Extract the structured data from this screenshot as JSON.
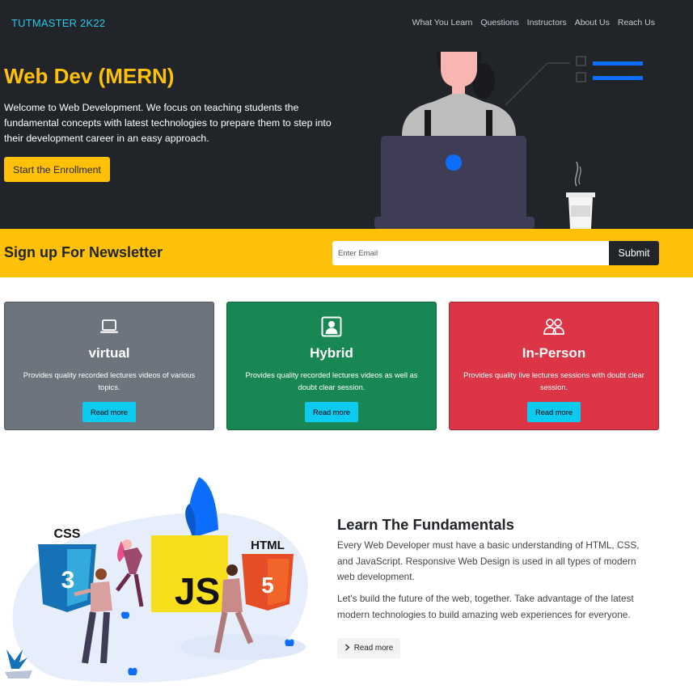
{
  "navbar": {
    "brand": "TUTMASTER 2K22",
    "links": [
      "What You Learn",
      "Questions",
      "Instructors",
      "About Us",
      "Reach Us"
    ]
  },
  "hero": {
    "title": "Web Dev (MERN)",
    "text": "Welcome to Web Development. We focus on teaching students the fundamental concepts with latest technologies to prepare them to step into their development career in an easy approach.",
    "button": "Start the Enrollment"
  },
  "newsletter": {
    "title": "Sign up For Newsletter",
    "placeholder": "Enter Email",
    "button": "Submit"
  },
  "cards": [
    {
      "icon": "laptop-icon",
      "title": "virtual",
      "text": "Provides quality recorded lectures videos of various topics.",
      "button": "Read more",
      "color": "#6c757d"
    },
    {
      "icon": "person-badge-icon",
      "title": "Hybrid",
      "text": "Provides quality recorded lectures videos as well as doubt clear session.",
      "button": "Read more",
      "color": "#198754"
    },
    {
      "icon": "people-icon",
      "title": "In-Person",
      "text": "Provides quality live lectures sessions with doubt clear session.",
      "button": "Read more",
      "color": "#dc3545"
    }
  ],
  "fundamentals": {
    "title": "Learn The Fundamentals",
    "p1": "Every Web Developer must have a basic understanding of HTML, CSS, and JavaScript. Responsive Web Design is used in all types of modern web development.",
    "p2": "Let's build the future of the web, together. Take advantage of the latest modern technologies to build amazing web experiences for everyone.",
    "button": "Read more",
    "logos": {
      "css": "CSS",
      "html": "HTML",
      "js": "JS"
    }
  },
  "colors": {
    "dark": "#212529",
    "accent": "#ffc107",
    "brand": "#2ec4e8",
    "info": "#0dcaf0"
  }
}
